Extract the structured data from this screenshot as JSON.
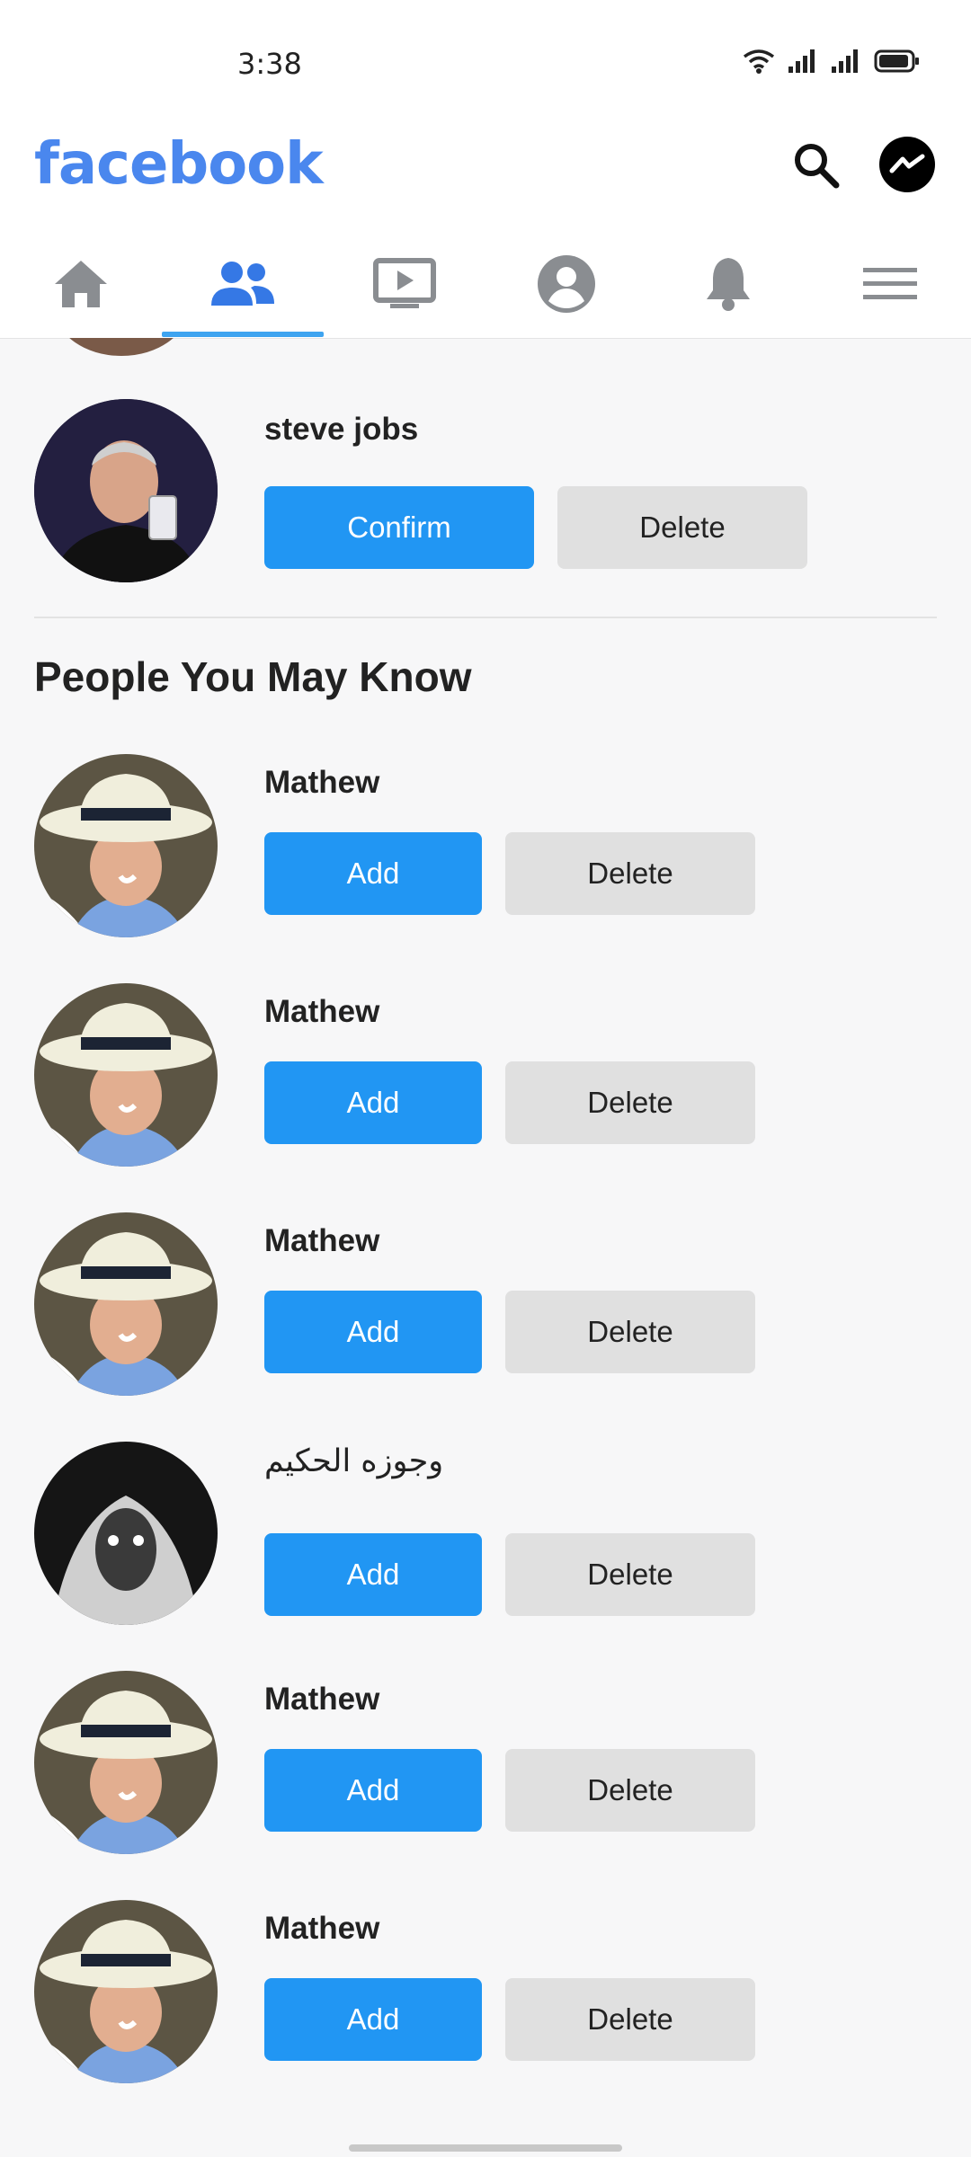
{
  "status": {
    "time": "3:38"
  },
  "header": {
    "logo": "facebook",
    "icons": [
      "search-icon",
      "messenger-icon"
    ]
  },
  "tabs": [
    {
      "name": "home",
      "icon": "home-icon",
      "active": false
    },
    {
      "name": "friends",
      "icon": "friends-icon",
      "active": true
    },
    {
      "name": "watch",
      "icon": "video-icon",
      "active": false
    },
    {
      "name": "profile",
      "icon": "profile-icon",
      "active": false
    },
    {
      "name": "notifications",
      "icon": "bell-icon",
      "active": false
    },
    {
      "name": "menu",
      "icon": "menu-icon",
      "active": false
    }
  ],
  "requests": [
    {
      "name": "steve jobs",
      "confirm": "Confirm",
      "delete": "Delete"
    }
  ],
  "pymk": {
    "title": "People You May Know",
    "people": [
      {
        "name": "Mathew",
        "add": "Add",
        "delete": "Delete"
      },
      {
        "name": "Mathew",
        "add": "Add",
        "delete": "Delete"
      },
      {
        "name": "Mathew",
        "add": "Add",
        "delete": "Delete"
      },
      {
        "name": "وجوزه الحكيم",
        "add": "Add",
        "delete": "Delete"
      },
      {
        "name": "Mathew",
        "add": "Add",
        "delete": "Delete"
      },
      {
        "name": "Mathew",
        "add": "Add",
        "delete": "Delete"
      }
    ]
  },
  "colors": {
    "brand": "#4a87ee",
    "primary_button": "#2196f3",
    "secondary_button": "#e0e0e0",
    "active_tab": "#3ea4f0"
  }
}
